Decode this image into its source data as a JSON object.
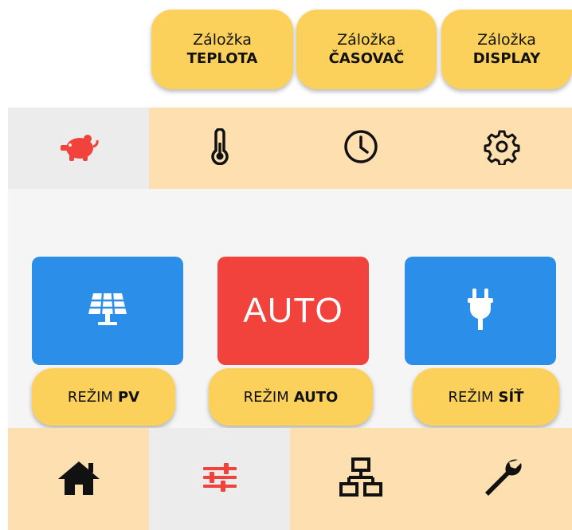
{
  "callouts": {
    "teplota": {
      "line1": "Záložka",
      "line2": "TEPLOTA"
    },
    "casovac": {
      "line1": "Záložka",
      "line2": "ČASOVAČ"
    },
    "display": {
      "line1": "Záložka",
      "line2": "DISPLAY"
    },
    "rezim_pv": {
      "prefix": "REŽIM",
      "bold": "PV"
    },
    "rezim_auto": {
      "prefix": "REŽIM",
      "bold": "AUTO"
    },
    "rezim_sit": {
      "prefix": "REŽIM",
      "bold": "SÍŤ"
    }
  },
  "tabs": [
    {
      "icon": "piggy-bank-icon",
      "active": true
    },
    {
      "icon": "thermometer-icon",
      "active": false
    },
    {
      "icon": "clock-icon",
      "active": false
    },
    {
      "icon": "gear-icon",
      "active": false
    }
  ],
  "modes": {
    "pv": {
      "icon": "solar-panel-icon"
    },
    "auto": {
      "label": "AUTO"
    },
    "grid": {
      "icon": "plug-icon"
    }
  },
  "bottom_nav": [
    {
      "icon": "home-icon",
      "active": false
    },
    {
      "icon": "sliders-icon",
      "active": true
    },
    {
      "icon": "network-icon",
      "active": false
    },
    {
      "icon": "wrench-icon",
      "active": false
    }
  ],
  "colors": {
    "callout": "#fbd15b",
    "bar": "#fddfb0",
    "active_tab": "#ececec",
    "accent_red": "#f1423b",
    "mode_blue": "#2b8ee8"
  }
}
